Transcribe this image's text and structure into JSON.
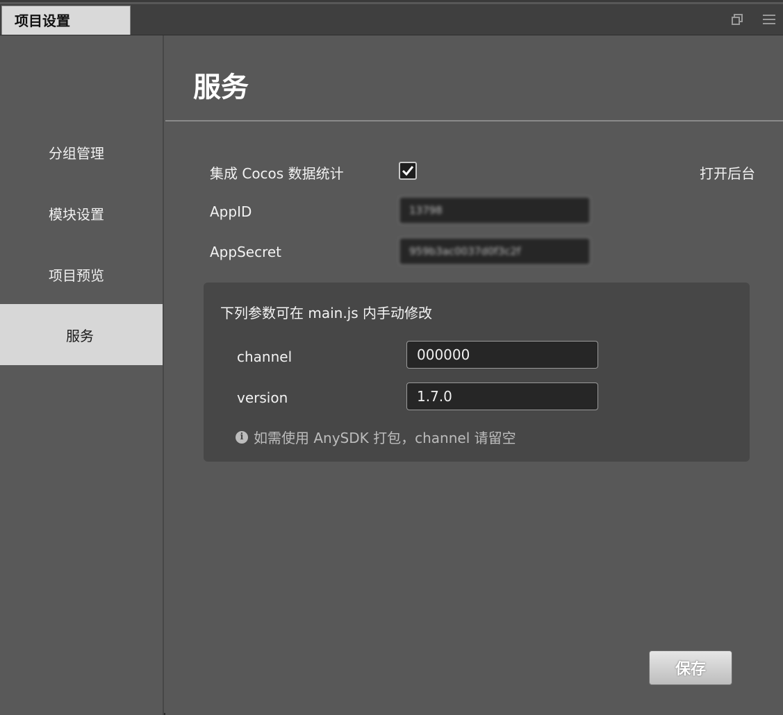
{
  "tab": {
    "title": "项目设置"
  },
  "tab_actions": {
    "icons": [
      "restore-window-icon",
      "menu-icon"
    ]
  },
  "sidebar": {
    "items": [
      {
        "label": "分组管理",
        "active": false
      },
      {
        "label": "模块设置",
        "active": false
      },
      {
        "label": "项目预览",
        "active": false
      },
      {
        "label": "服务",
        "active": true
      }
    ]
  },
  "main": {
    "title": "服务",
    "integrate_label": "集成 Cocos 数据统计",
    "integrate_checked": true,
    "open_backend": "打开后台",
    "appid_label": "AppID",
    "appid_value": "13798",
    "appsecret_label": "AppSecret",
    "appsecret_value": "959b3ac0037d0f3c2f"
  },
  "panel": {
    "title": "下列参数可在 main.js 内手动修改",
    "channel_label": "channel",
    "channel_value": "000000",
    "version_label": "version",
    "version_value": "1.7.0",
    "hint": "如需使用 AnySDK 打包，channel 请留空"
  },
  "save_label": "保存"
}
